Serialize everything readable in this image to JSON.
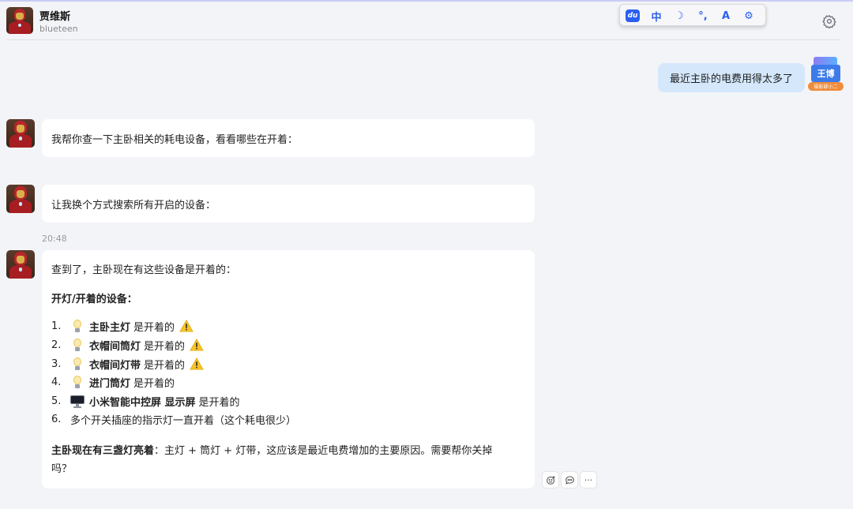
{
  "header": {
    "name": "贾维斯",
    "username": "blueteen",
    "settings_icon": "gear-icon"
  },
  "ime_toolbar": {
    "items": [
      {
        "icon": "du-logo-icon",
        "label": "du"
      },
      {
        "icon": "chinese-mode-icon",
        "label": "中"
      },
      {
        "icon": "moon-icon",
        "label": "☽"
      },
      {
        "icon": "punctuation-icon",
        "label": "°,"
      },
      {
        "icon": "skin-icon",
        "label": "A"
      },
      {
        "icon": "gear-icon",
        "label": "⚙"
      }
    ]
  },
  "user_message": {
    "text": "最近主卧的电费用得太多了",
    "avatar_label": "王博",
    "avatar_badge": "摄影師小二"
  },
  "bot_messages": [
    {
      "text": "我帮你查一下主卧相关的耗电设备，看看哪些在开着："
    },
    {
      "text": "让我换个方式搜索所有开启的设备："
    }
  ],
  "timestamp": "20:48",
  "final_message": {
    "intro": "查到了，主卧现在有这些设备是开着的：",
    "section_title": "开灯/开着的设备：",
    "items": [
      {
        "num": "1.",
        "icon": "lightbulb-icon",
        "name": "主卧主灯",
        "status": "是开着的",
        "warning": true
      },
      {
        "num": "2.",
        "icon": "lightbulb-icon",
        "name": "衣帽间筒灯",
        "status": "是开着的",
        "warning": true
      },
      {
        "num": "3.",
        "icon": "lightbulb-icon",
        "name": "衣帽间灯带",
        "status": "是开着的",
        "warning": true
      },
      {
        "num": "4.",
        "icon": "lightbulb-icon",
        "name": "进门筒灯",
        "status": "是开着的",
        "warning": false
      },
      {
        "num": "5.",
        "icon": "monitor-icon",
        "name": "小米智能中控屏 显示屏",
        "status": "是开着的",
        "warning": false
      },
      {
        "num": "6.",
        "icon": "",
        "name": "",
        "status": "多个开关插座的指示灯一直开着（这个耗电很少）",
        "warning": false
      }
    ],
    "summary_bold": "主卧现在有三盏灯亮着",
    "summary_rest": "：主灯 + 筒灯 + 灯带，这应该是最近电费增加的主要原因。需要帮你关掉",
    "summary_line2": "吗？"
  },
  "message_actions": [
    {
      "icon": "add-reaction-icon"
    },
    {
      "icon": "comment-icon"
    },
    {
      "icon": "more-icon",
      "label": "···"
    }
  ]
}
